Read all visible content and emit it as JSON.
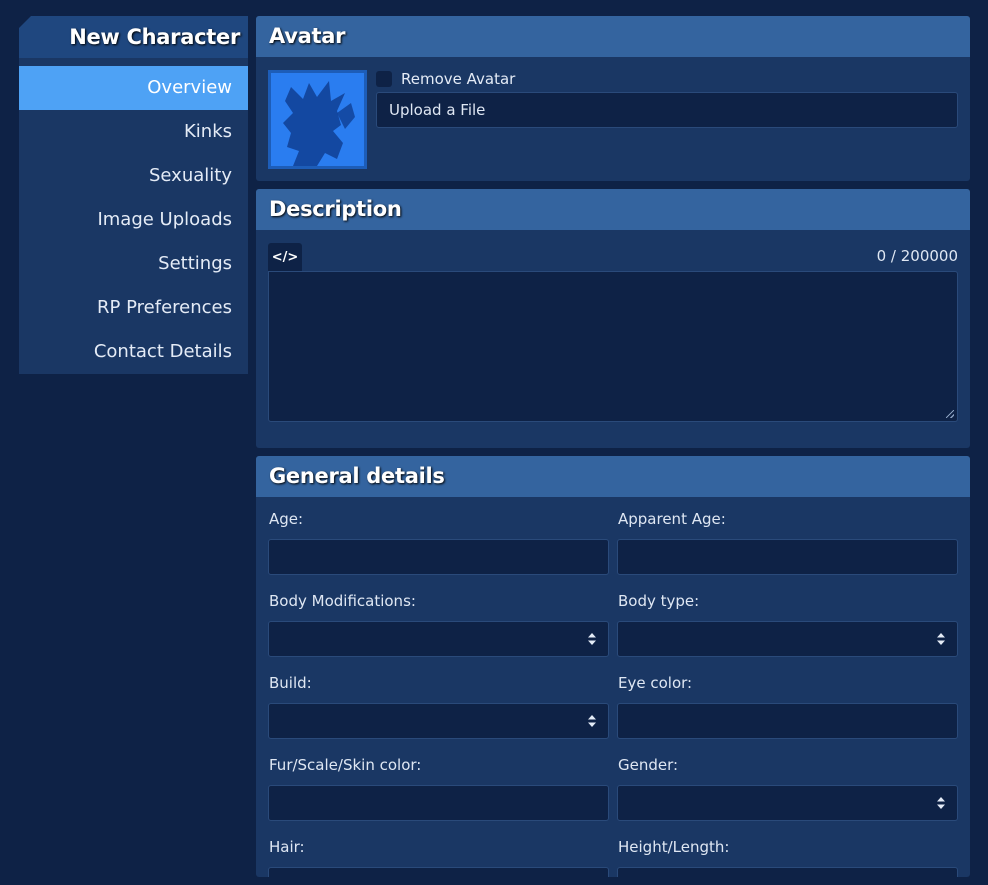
{
  "sidebar": {
    "title": "New Character",
    "items": [
      {
        "label": "Overview",
        "active": true
      },
      {
        "label": "Kinks"
      },
      {
        "label": "Sexuality"
      },
      {
        "label": "Image Uploads"
      },
      {
        "label": "Settings"
      },
      {
        "label": "RP Preferences"
      },
      {
        "label": "Contact Details"
      }
    ]
  },
  "avatar": {
    "title": "Avatar",
    "remove_label": "Remove Avatar",
    "remove_checked": false,
    "upload_label": "Upload a File"
  },
  "description": {
    "title": "Description",
    "code_icon": "</>",
    "char_count": "0 / 200000",
    "value": ""
  },
  "details": {
    "title": "General details",
    "fields": [
      {
        "label": "Age:",
        "type": "text",
        "value": ""
      },
      {
        "label": "Apparent Age:",
        "type": "text",
        "value": ""
      },
      {
        "label": "Body Modifications:",
        "type": "select",
        "value": ""
      },
      {
        "label": "Body type:",
        "type": "select",
        "value": ""
      },
      {
        "label": "Build:",
        "type": "select",
        "value": ""
      },
      {
        "label": "Eye color:",
        "type": "text",
        "value": ""
      },
      {
        "label": "Fur/Scale/Skin color:",
        "type": "text",
        "value": ""
      },
      {
        "label": "Gender:",
        "type": "select",
        "value": ""
      },
      {
        "label": "Hair:",
        "type": "text",
        "value": ""
      },
      {
        "label": "Height/Length:",
        "type": "text",
        "value": ""
      }
    ]
  },
  "colors": {
    "background": "#0e2246",
    "panel": "#1a3764",
    "panel_header": "#34649f",
    "active_nav": "#4ea2f5",
    "avatar_blue": "#2a7df0"
  }
}
